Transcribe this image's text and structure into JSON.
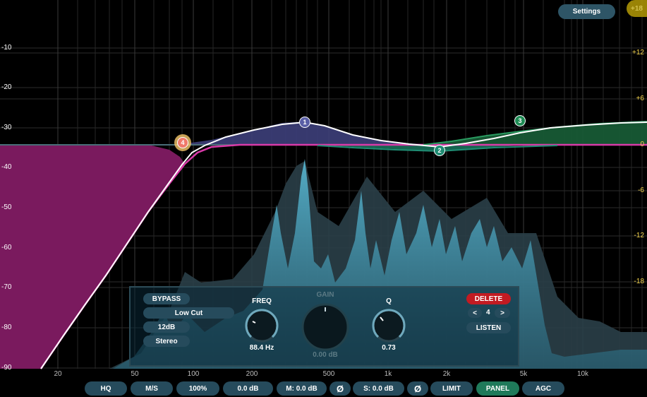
{
  "settings_button": {
    "label": "Settings"
  },
  "gain_bubble": {
    "label": "+18",
    "color": "#b49b06"
  },
  "db_axis_left": [
    "-10",
    "-20",
    "-30",
    "-40",
    "-50",
    "-60",
    "-70",
    "-80",
    "-90"
  ],
  "db_axis_right": [
    "+12",
    "+6",
    "0",
    "-6",
    "-12",
    "-18"
  ],
  "freq_axis": [
    "20",
    "50",
    "100",
    "200",
    "500",
    "1k",
    "2k",
    "5k",
    "10k"
  ],
  "bands": [
    {
      "id": "1",
      "color": "#5a5fa6"
    },
    {
      "id": "2",
      "color": "#1f8c73"
    },
    {
      "id": "3",
      "color": "#1f8c55"
    },
    {
      "id": "4",
      "color": "#f0786a"
    }
  ],
  "band_panel": {
    "bypass": "BYPASS",
    "filter_type": "Low Cut",
    "slope": "12dB",
    "channel": "Stereo",
    "freq_label": "FREQ",
    "freq_value": "88.4 Hz",
    "gain_label": "GAIN",
    "gain_value": "0.00 dB",
    "q_label": "Q",
    "q_value": "0.73",
    "delete": "DELETE",
    "prev": "<",
    "next": ">",
    "band_number": "4",
    "listen": "LISTEN"
  },
  "bottom_bar": {
    "hq": "HQ",
    "ms": "M/S",
    "zoom": "100%",
    "output_gain": "0.0 dB",
    "mid_gain": "M: 0.0 dB",
    "mid_phase": "Ø",
    "side_gain": "S: 0.0 dB",
    "side_phase": "Ø",
    "limit": "LIMIT",
    "panel": "PANEL",
    "agc": "AGC"
  },
  "colors": {
    "lowcut_fill": "#7a1a5e",
    "lowcut_line": "#d93aa8",
    "spectrum": "#4fa9c4",
    "active_toggle": "#1f7a5a",
    "delete": "#c21b22"
  }
}
